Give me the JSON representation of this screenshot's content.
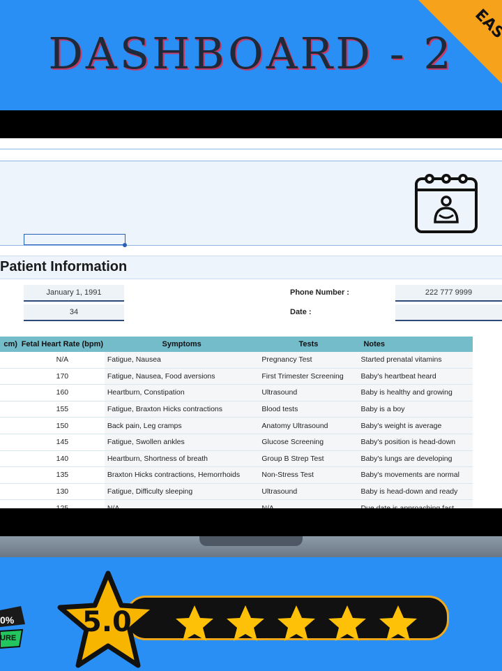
{
  "banner": {
    "title": "DASHBOARD - 2",
    "corner_tag": "EAS"
  },
  "sheet": {
    "section_title": "Patient Information",
    "fields": {
      "dob": "January 1, 1991",
      "age": "34",
      "phone_label": "Phone Number :",
      "phone": "222 777 9999",
      "date_label": "Date :",
      "date": ""
    },
    "columns": [
      "cm)",
      "Fetal Heart Rate (bpm)",
      "Symptoms",
      "Tests",
      "Notes"
    ],
    "rows": [
      [
        "",
        "N/A",
        "Fatigue, Nausea",
        "Pregnancy Test",
        "Started prenatal vitamins"
      ],
      [
        "",
        "170",
        "Fatigue, Nausea, Food aversions",
        "First Trimester Screening",
        "Baby's heartbeat heard"
      ],
      [
        "",
        "160",
        "Heartburn, Constipation",
        "Ultrasound",
        "Baby is healthy and growing"
      ],
      [
        "",
        "155",
        "Fatigue, Braxton Hicks contractions",
        "Blood tests",
        "Baby is a boy"
      ],
      [
        "",
        "150",
        "Back pain, Leg cramps",
        "Anatomy Ultrasound",
        "Baby's weight is average"
      ],
      [
        "",
        "145",
        "Fatigue, Swollen ankles",
        "Glucose Screening",
        "Baby's position is head-down"
      ],
      [
        "",
        "140",
        "Heartburn, Shortness of breath",
        "Group B Strep Test",
        "Baby's lungs are developing"
      ],
      [
        "",
        "135",
        "Braxton Hicks contractions, Hemorrhoids",
        "Non-Stress Test",
        "Baby's movements are normal"
      ],
      [
        "",
        "130",
        "Fatigue, Difficulty sleeping",
        "Ultrasound",
        "Baby is head-down and ready"
      ],
      [
        "",
        "125",
        "N/A",
        "N/A",
        "Due date is approaching fast"
      ]
    ]
  },
  "rating": {
    "score": "5.0",
    "stars": 5
  },
  "badge": {
    "line1": "0%",
    "line2": "URE"
  },
  "colors": {
    "background": "#2a8ff5",
    "accent": "#f7a21b",
    "star": "#ffc107",
    "table_header": "#75bccb"
  }
}
